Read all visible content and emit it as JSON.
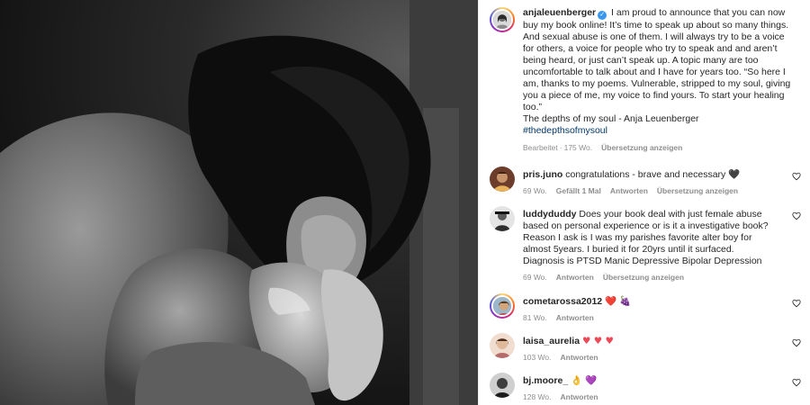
{
  "post": {
    "username": "anjaleuenberger",
    "verified_mark": "✓",
    "caption": "I am proud to announce that you can now buy my book online! It’s time to speak up about so many things. And sexual abuse is one of them. I will always try to be a voice for others, a voice for people who try to speak and and aren’t being heard, or just can’t speak up. A topic many are too uncomfortable to talk about and I have for years too. “So here I am, thanks to my poems. Vulnerable, stripped to my soul, giving you a piece of me, my voice to find yours. To start your healing too.”",
    "caption_line2": "The depths of my soul - Anja Leuenberger",
    "hashtag": "#thedepthsofmysoul",
    "edited": "Bearbeitet",
    "separator": "·",
    "age": "175 Wo.",
    "translate": "Übersetzung anzeigen"
  },
  "comments": [
    {
      "username": "pris.juno",
      "text": "congratulations - brave and necessary",
      "emoji": "🖤",
      "age": "69 Wo.",
      "likes": "Gefällt 1 Mal",
      "reply": "Antworten",
      "translate": "Übersetzung anzeigen"
    },
    {
      "username": "luddyduddy",
      "text": "Does your book deal with just female abuse based on personal experience or is it a investigative book? Reason I ask is I was my parishes favorite alter boy for almost 5years. I buried it for 20yrs until it surfaced. Diagnosis is PTSD Manic Depressive Bipolar Depression",
      "age": "69 Wo.",
      "reply": "Antworten",
      "translate": "Übersetzung anzeigen"
    },
    {
      "username": "cometarossa2012",
      "emoji": "❤️",
      "emoji2": "🍇",
      "age": "81 Wo.",
      "reply": "Antworten"
    },
    {
      "username": "laisa_aurelia",
      "emoji": "♥ ♥ ♥",
      "age": "103 Wo.",
      "reply": "Antworten"
    },
    {
      "username": "bj.moore_",
      "emoji": "👌",
      "emoji2": "💜",
      "age": "128 Wo.",
      "reply": "Antworten"
    }
  ],
  "colors": {
    "link": "#00376b",
    "verified": "#3897f0",
    "meta": "#8e8e8e",
    "heart_red": "#ed4956"
  }
}
